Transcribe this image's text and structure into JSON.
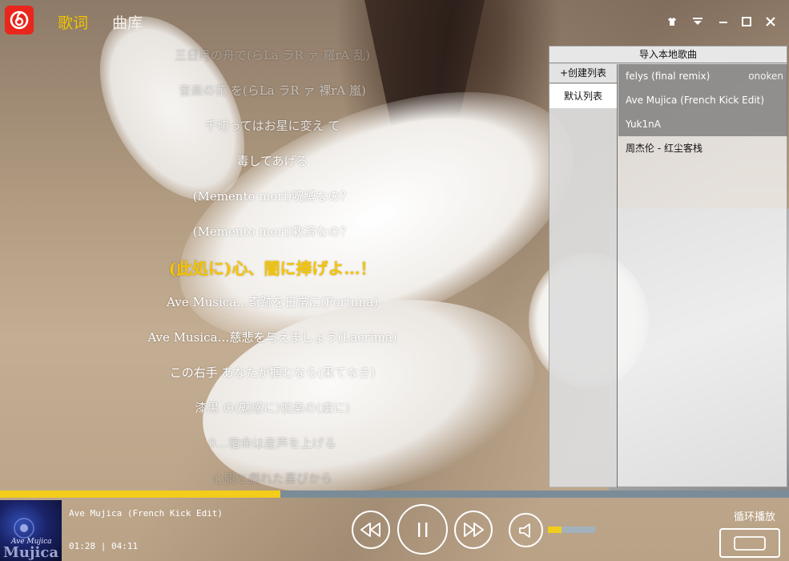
{
  "header": {
    "tabs": [
      {
        "label": "歌词",
        "active": true
      },
      {
        "label": "曲库",
        "active": false
      }
    ],
    "window_controls": [
      "skin-icon",
      "menu-icon",
      "minimize-icon",
      "maximize-icon",
      "close-icon"
    ]
  },
  "lyrics": {
    "lines": [
      "三日月の舟で(らLa ラR ァ 羅rA 乱)",
      "音楽の花 を(らLa ラR ァ 裸rA 嵐)",
      "千切ってはお星に変え て",
      "毒してあげる",
      "(Memento mori)呪縛なの？",
      "(Memento mori)救済なの？",
      "(此処に)心、闇に捧げよ…！",
      "Ave Musica…奇跡を日常に(Fortuna)",
      "Ave Musica…慈悲を与えましょう(Lacrima)",
      "この右手 あなたが掴むなら(果てなき)",
      "漆黒 の(魅惑に)悦楽の(虜に)",
      "0…宿命は産声を上げる",
      "心臓と戯れた喜びから"
    ],
    "current_index": 6,
    "line_opacity": [
      0.35,
      0.55,
      0.8,
      0.95,
      1,
      1,
      1,
      1,
      1,
      1,
      0.85,
      0.6,
      0.3
    ]
  },
  "playlist": {
    "import_label": "导入本地歌曲",
    "create_label": "+创建列表",
    "lists": [
      {
        "label": "默认列表",
        "selected": true
      }
    ],
    "songs": [
      {
        "title": "felys (final remix)",
        "artist": "onoken",
        "highlighted": true
      },
      {
        "title": "Ave Mujica (French Kick Edit)",
        "artist": "",
        "highlighted": true
      },
      {
        "title": "Yuk1nA",
        "artist": "",
        "highlighted": true
      },
      {
        "title": "周杰伦 - 红尘客栈",
        "artist": "",
        "highlighted": false
      }
    ]
  },
  "player": {
    "progress_percent": 35.5,
    "now_playing_title": "Ave Mujica (French Kick Edit)",
    "elapsed": "01:28",
    "separator": "|",
    "duration": "04:11",
    "volume_percent": 28,
    "loop_mode_label": "循环播放",
    "album_art": {
      "small_text": "Ave Mujica",
      "large_text": "Mujica"
    }
  },
  "colors": {
    "accent": "#f2cd1b",
    "logo_red": "#e8261c",
    "progress_track": "#7b8c99"
  }
}
